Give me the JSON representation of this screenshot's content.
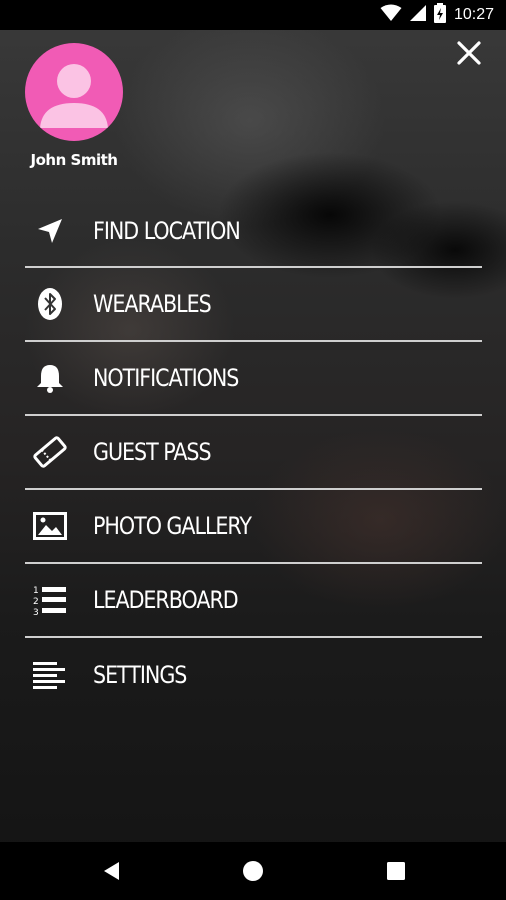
{
  "status_bar": {
    "time": "10:27",
    "icons": [
      "wifi-icon",
      "cell-signal-icon",
      "battery-icon"
    ]
  },
  "drawer": {
    "close_icon": "close-icon",
    "user": {
      "name": "John Smith",
      "avatar_color": "#f15bb5",
      "avatar_icon": "person-icon"
    },
    "menu_items": [
      {
        "label": "FIND LOCATION",
        "icon": "navigation-arrow-icon"
      },
      {
        "label": "WEARABLES",
        "icon": "bluetooth-icon"
      },
      {
        "label": "NOTIFICATIONS",
        "icon": "bell-icon"
      },
      {
        "label": "GUEST PASS",
        "icon": "ticket-icon"
      },
      {
        "label": "PHOTO GALLERY",
        "icon": "image-icon"
      },
      {
        "label": "LEADERBOARD",
        "icon": "ordered-list-icon"
      },
      {
        "label": "SETTINGS",
        "icon": "align-left-lines-icon"
      }
    ],
    "divider_color": "#cfcfcf"
  },
  "nav_bar": {
    "buttons": [
      "back-icon",
      "home-icon",
      "recents-icon"
    ]
  }
}
